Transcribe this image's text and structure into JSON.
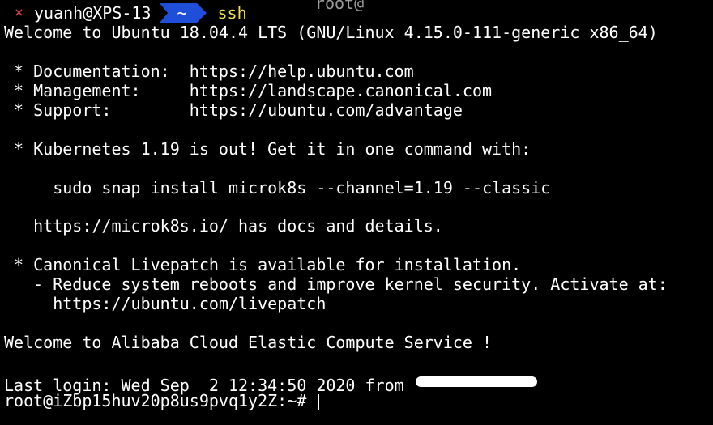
{
  "prompt": {
    "status_symbol": "×",
    "user_host": "yuanh@XPS-13",
    "directory": "~",
    "command": "ssh",
    "argument": "root@"
  },
  "output": [
    "Welcome to Ubuntu 18.04.4 LTS (GNU/Linux 4.15.0-111-generic x86_64)",
    "",
    " * Documentation:  https://help.ubuntu.com",
    " * Management:     https://landscape.canonical.com",
    " * Support:        https://ubuntu.com/advantage",
    "",
    " * Kubernetes 1.19 is out! Get it in one command with:",
    "",
    "     sudo snap install microk8s --channel=1.19 --classic",
    "",
    "   https://microk8s.io/ has docs and details.",
    "",
    " * Canonical Livepatch is available for installation.",
    "   - Reduce system reboots and improve kernel security. Activate at:",
    "     https://ubuntu.com/livepatch",
    "",
    "Welcome to Alibaba Cloud Elastic Compute Service !",
    ""
  ],
  "last_login": {
    "text": "Last login: Wed Sep  2 12:34:50 2020 from "
  },
  "remote_prompt": "root@iZbp15huv20p8us9pvq1y2Z:~# ",
  "colors": {
    "background": "#000000",
    "foreground": "#ffffff",
    "error": "#e0464a",
    "dir_segment": "#1f4fd8",
    "command": "#f2e14e"
  }
}
